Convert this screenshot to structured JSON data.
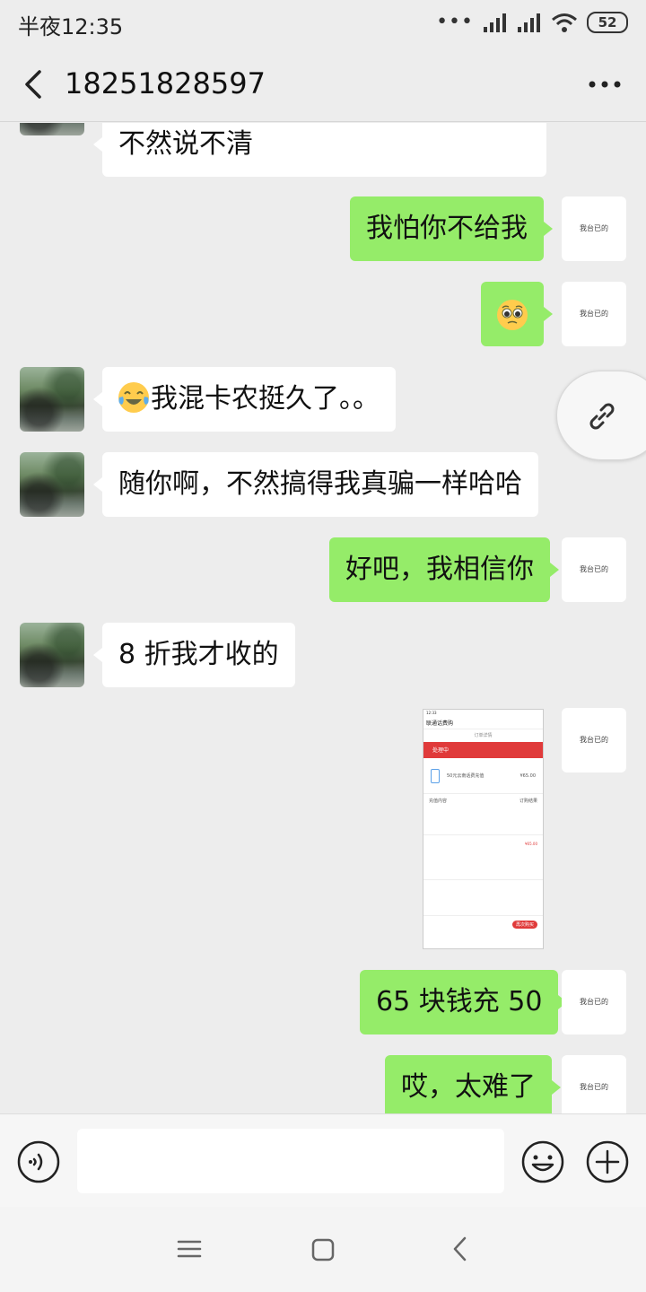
{
  "status_bar": {
    "time": "半夜12:35",
    "battery": "52"
  },
  "header": {
    "title": "18251828597"
  },
  "avatar_self_text": "我台已的",
  "messages": [
    {
      "side": "left",
      "text": "不然说不清"
    },
    {
      "side": "right",
      "text": "我怕你不给我"
    },
    {
      "side": "right",
      "text": "",
      "emoji": "pleading-face"
    },
    {
      "side": "left",
      "text": "我混卡农挺久了。。",
      "emoji": "tears-of-joy"
    },
    {
      "side": "left",
      "text": "随你啊，不然搞得我真骗一样哈哈"
    },
    {
      "side": "right",
      "text": "好吧，我相信你"
    },
    {
      "side": "left",
      "text": "8 折我才收的"
    },
    {
      "side": "right",
      "text": "",
      "image": "order-screenshot"
    },
    {
      "side": "right",
      "text": "65 块钱充 50"
    },
    {
      "side": "right",
      "text": "哎，太难了"
    }
  ],
  "screenshot": {
    "app_title": "联通话费购",
    "order_detail": "订单详情",
    "status": "处理中",
    "product": "50元云南话费充值",
    "price": "¥65.00",
    "recharge_content": "充值内容",
    "order_result": "订购结果",
    "amount_total": "¥65.00",
    "button": "再次购买"
  },
  "input": {
    "placeholder": ""
  },
  "icons": {
    "back": "chevron-left-icon",
    "more": "more-dots-icon",
    "link": "link-icon",
    "voice": "voice-icon",
    "emoji": "emoji-icon",
    "plus": "plus-icon",
    "menu": "menu-icon",
    "home": "home-icon",
    "nav_back": "nav-back-icon"
  },
  "colors": {
    "bubble_right": "#95ec69",
    "bubble_left": "#ffffff",
    "background": "#ededed"
  }
}
